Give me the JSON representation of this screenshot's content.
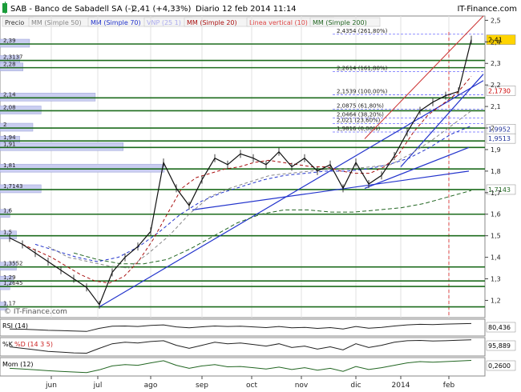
{
  "header": {
    "title": "SAB - Banco de Sabadell SA (-)",
    "price_change": "2,41 (+4,33%)",
    "period": "Diario",
    "date": "12 feb 2014 11:14",
    "source": "IT-Finance.com"
  },
  "legend": [
    {
      "label": "Precio",
      "color": "#333333"
    },
    {
      "label": "MM (Simple 50)",
      "color": "#888888"
    },
    {
      "label": "MM (Simple 70)",
      "color": "#2233cc"
    },
    {
      "label": "VNP (25 1)",
      "color": "#aaaaee"
    },
    {
      "label": "MM (Simple 20)",
      "color": "#aa1111"
    },
    {
      "label": "Linea vertical (10)",
      "color": "#dd4444"
    },
    {
      "label": "MM (Simple 200)",
      "color": "#226622"
    }
  ],
  "watermark": "© IT-Finance.com",
  "chart_data": {
    "type": "line",
    "title": "SAB - Banco de Sabadell SA (-)",
    "ylim": [
      1.12,
      2.52
    ],
    "y_axis_ticks": [
      "2,5",
      "2,4",
      "2,3",
      "2,2",
      "2,1",
      "2",
      "1,9",
      "1,8",
      "1,7",
      "1,6",
      "1,5",
      "1,4",
      "1,3",
      "1,2"
    ],
    "x_axis_ticks": [
      "jun",
      "jul",
      "ago",
      "sep",
      "oct",
      "nov",
      "dic",
      "2014",
      "feb"
    ],
    "last_value": "2,41",
    "price_series": {
      "name": "Precio",
      "dates": [
        "may",
        "jun",
        "jun",
        "jun",
        "jun",
        "jun",
        "jun",
        "jul",
        "jul",
        "jul",
        "jul",
        "ago",
        "ago",
        "ago",
        "ago",
        "sep",
        "sep",
        "sep",
        "sep",
        "oct",
        "oct",
        "oct",
        "oct",
        "nov",
        "nov",
        "nov",
        "nov",
        "dic",
        "dic",
        "dic",
        "dic",
        "2014",
        "2014",
        "2014",
        "2014",
        "feb",
        "feb"
      ],
      "values": [
        1.49,
        1.46,
        1.42,
        1.38,
        1.34,
        1.3,
        1.26,
        1.18,
        1.33,
        1.4,
        1.45,
        1.52,
        1.84,
        1.72,
        1.64,
        1.76,
        1.86,
        1.83,
        1.88,
        1.86,
        1.83,
        1.89,
        1.82,
        1.86,
        1.8,
        1.83,
        1.72,
        1.84,
        1.74,
        1.78,
        1.87,
        1.98,
        2.08,
        2.12,
        2.15,
        2.17,
        2.41
      ]
    },
    "sma20": {
      "name": "MM (Simple 20)",
      "values": [
        1.46,
        1.43,
        1.4,
        1.36,
        1.32,
        1.29,
        1.28,
        1.31,
        1.38,
        1.48,
        1.6,
        1.72,
        1.77,
        1.79,
        1.81,
        1.82,
        1.84,
        1.85,
        1.84,
        1.83,
        1.82,
        1.82,
        1.8,
        1.79,
        1.79,
        1.82,
        1.88,
        1.98,
        2.06,
        2.11,
        2.16,
        2.24
      ]
    },
    "sma50": {
      "name": "MM (Simple 50)",
      "values": [
        1.45,
        1.4,
        1.38,
        1.36,
        1.35,
        1.42,
        1.5,
        1.6,
        1.68,
        1.72,
        1.75,
        1.78,
        1.79,
        1.8,
        1.81,
        1.81,
        1.82,
        1.83,
        1.88,
        1.94,
        2.01,
        2.08
      ]
    },
    "sma70": {
      "name": "MM (Simple 70)",
      "values": [
        1.46,
        1.43,
        1.4,
        1.38,
        1.4,
        1.45,
        1.52,
        1.6,
        1.66,
        1.7,
        1.73,
        1.76,
        1.78,
        1.79,
        1.8,
        1.8,
        1.81,
        1.83,
        1.86,
        1.91,
        1.97,
        2.01
      ]
    },
    "sma200": {
      "name": "MM (Simple 200)",
      "values": [
        1.42,
        1.39,
        1.37,
        1.37,
        1.39,
        1.44,
        1.5,
        1.56,
        1.6,
        1.62,
        1.62,
        1.61,
        1.61,
        1.62,
        1.63,
        1.65,
        1.68,
        1.71
      ]
    },
    "price_labels": [
      {
        "label": "2,41",
        "value": 2.41
      },
      {
        "label": "2,1730",
        "value": 2.173
      },
      {
        "label": "1,9952",
        "value": 1.9952
      },
      {
        "label": "1,9513",
        "value": 1.9513
      },
      {
        "label": "1,7143",
        "value": 1.7143
      }
    ],
    "horizontal_levels": [
      2.39,
      2.3137,
      2.28,
      2.14,
      2.08,
      2.0,
      1.94,
      1.91,
      1.81,
      1.7143,
      1.6,
      1.5,
      1.3552,
      1.29,
      1.2645,
      1.17
    ],
    "horizontal_level_labels": [
      "2,39",
      "2,3137",
      "2,28",
      "2,14",
      "2,08",
      "2",
      "1,94",
      "1,91",
      "1,81",
      "1,7143",
      "1,6",
      "1,5",
      "1,3552",
      "1,29",
      "1,2645",
      "1,17"
    ],
    "fibonacci": [
      {
        "label": "2,4354 (261,80%)",
        "value": 2.4354
      },
      {
        "label": "2,2614 (161,80%)",
        "value": 2.2614
      },
      {
        "label": "2,1539 (100,00%)",
        "value": 2.1539
      },
      {
        "label": "2,0875 (61,80%)",
        "value": 2.0875
      },
      {
        "label": "2,0464 (38,20%)",
        "value": 2.0464
      },
      {
        "label": "2,021 (23,60%)",
        "value": 2.021
      },
      {
        "label": "1,9816 (0,00%)",
        "value": 1.9816
      }
    ],
    "volume_profile": [
      {
        "price": 2.39,
        "volume": 0.18
      },
      {
        "price": 2.3137,
        "volume": 0.12
      },
      {
        "price": 2.28,
        "volume": 0.14
      },
      {
        "price": 2.14,
        "volume": 0.58
      },
      {
        "price": 2.08,
        "volume": 0.25
      },
      {
        "price": 2.0,
        "volume": 0.2
      },
      {
        "price": 1.94,
        "volume": 0.12
      },
      {
        "price": 1.91,
        "volume": 0.75
      },
      {
        "price": 1.81,
        "volume": 1.0
      },
      {
        "price": 1.7143,
        "volume": 0.25
      },
      {
        "price": 1.6,
        "volume": 0.06
      },
      {
        "price": 1.5,
        "volume": 0.1
      },
      {
        "price": 1.3552,
        "volume": 0.1
      },
      {
        "price": 1.29,
        "volume": 0.08
      },
      {
        "price": 1.2645,
        "volume": 0.06
      },
      {
        "price": 1.17,
        "volume": 0.04
      }
    ],
    "rsi": {
      "name": "RSI (14)",
      "value": "80,436",
      "values": [
        40,
        38,
        35,
        30,
        28,
        25,
        22,
        45,
        60,
        62,
        58,
        66,
        70,
        55,
        48,
        56,
        62,
        58,
        60,
        55,
        50,
        58,
        48,
        52,
        44,
        50,
        40,
        58,
        46,
        52,
        62,
        70,
        74,
        72,
        76,
        78,
        80
      ]
    },
    "stoch": {
      "name": "%K",
      "d_name": "%D (14 3 5)",
      "value": "95,889",
      "values": [
        50,
        40,
        30,
        20,
        15,
        10,
        8,
        40,
        70,
        80,
        75,
        85,
        90,
        60,
        40,
        60,
        80,
        70,
        75,
        65,
        55,
        70,
        45,
        55,
        35,
        50,
        30,
        70,
        45,
        60,
        80,
        90,
        92,
        88,
        90,
        93,
        96
      ]
    },
    "momentum": {
      "name": "Mom (12)",
      "value": "0,2600",
      "values": [
        0.0,
        -0.02,
        -0.05,
        -0.08,
        -0.1,
        -0.12,
        -0.14,
        -0.05,
        0.08,
        0.12,
        0.1,
        0.18,
        0.25,
        0.1,
        0.0,
        0.08,
        0.12,
        0.05,
        0.06,
        0.02,
        -0.02,
        0.04,
        -0.04,
        0.02,
        -0.06,
        0.0,
        -0.1,
        0.06,
        -0.04,
        0.02,
        0.1,
        0.18,
        0.22,
        0.2,
        0.22,
        0.24,
        0.26
      ]
    }
  }
}
